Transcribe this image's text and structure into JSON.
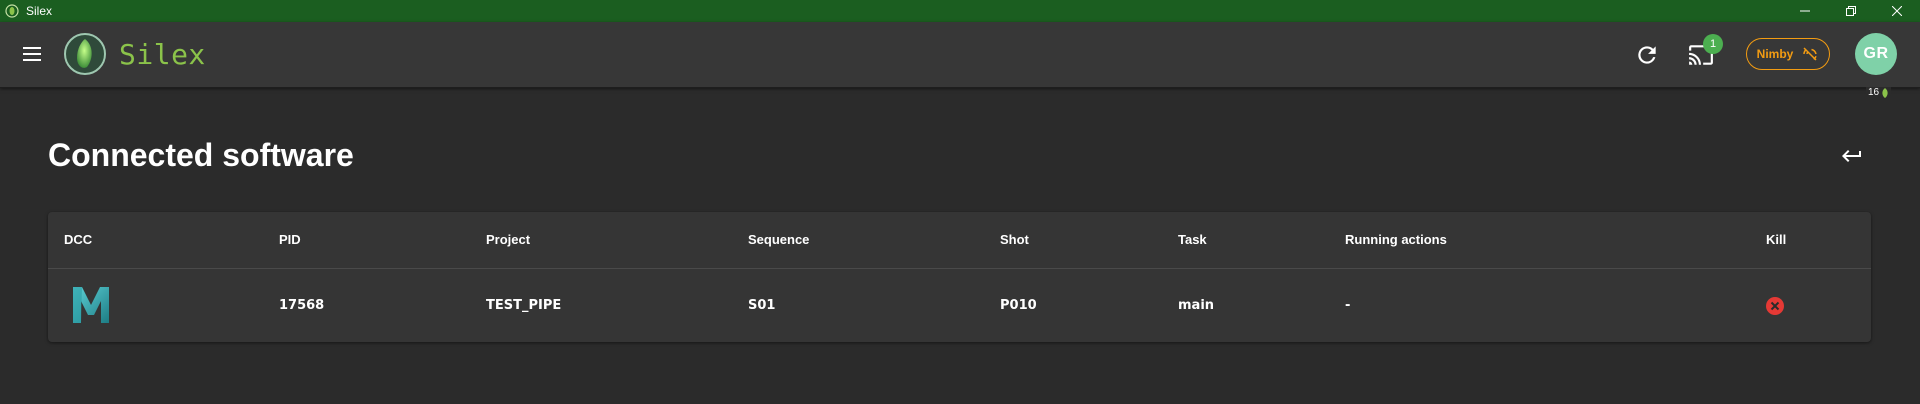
{
  "window": {
    "title": "Silex"
  },
  "app": {
    "brand": "Silex",
    "cast_badge": "1",
    "nimby_label": "Nimby",
    "avatar_initials": "GR",
    "avatar_level": "16"
  },
  "page": {
    "title": "Connected software"
  },
  "table": {
    "headers": [
      "DCC",
      "PID",
      "Project",
      "Sequence",
      "Shot",
      "Task",
      "Running actions",
      "Kill"
    ],
    "rows": [
      {
        "dcc": "maya",
        "pid": "17568",
        "project": "TEST_PIPE",
        "sequence": "S01",
        "shot": "P010",
        "task": "main",
        "running_actions": "-"
      }
    ]
  },
  "colors": {
    "titlebar": "#1b5e20",
    "appbar": "#373737",
    "background": "#2b2b2b",
    "brand": "#8bc34a",
    "nimby": "#f39c12",
    "avatar": "#7fd1a8",
    "kill": "#e53935",
    "badge": "#4caf50"
  },
  "icons": [
    "menu-icon",
    "refresh-icon",
    "cast-icon",
    "nimby-off-icon",
    "back-icon",
    "kill-icon",
    "maya-icon"
  ]
}
